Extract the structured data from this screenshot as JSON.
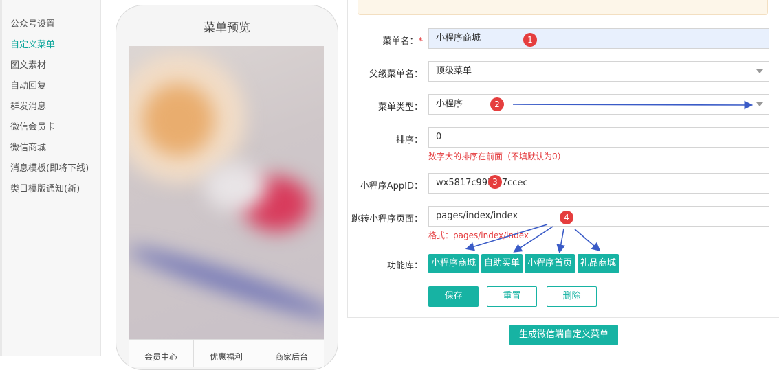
{
  "sidebar": {
    "items": [
      {
        "label": "公众号设置"
      },
      {
        "label": "自定义菜单"
      },
      {
        "label": "图文素材"
      },
      {
        "label": "自动回复"
      },
      {
        "label": "群发消息"
      },
      {
        "label": "微信会员卡"
      },
      {
        "label": "微信商城"
      },
      {
        "label": "消息模板(即将下线)"
      },
      {
        "label": "类目模版通知(新)"
      }
    ],
    "active_index": 1
  },
  "preview": {
    "title": "菜单预览",
    "tabs": [
      "会员中心",
      "优惠福利",
      "商家后台"
    ]
  },
  "form": {
    "menu_name": {
      "label": "菜单名：",
      "required_mark": "*",
      "value": "小程序商城"
    },
    "parent_menu": {
      "label": "父级菜单名：",
      "value": "顶级菜单"
    },
    "menu_type": {
      "label": "菜单类型：",
      "value": "小程序"
    },
    "sort": {
      "label": "排序：",
      "value": "0",
      "hint": "数字大的排序在前面（不填默认为0）"
    },
    "appid": {
      "label": "小程序AppID：",
      "value": "wx5817c99b2  7ccec"
    },
    "page": {
      "label": "跳转小程序页面：",
      "value": "pages/index/index",
      "hint": "格式：pages/index/index"
    },
    "func_lib": {
      "label": "功能库：",
      "buttons": [
        "小程序商城",
        "自助买单",
        "小程序首页",
        "礼品商城"
      ]
    }
  },
  "actions": {
    "save": "保存",
    "reset": "重置",
    "delete": "删除",
    "generate": "生成微信端自定义菜单"
  },
  "annotations": {
    "badges": [
      "1",
      "2",
      "3",
      "4"
    ],
    "badge_color": "#e53e3e",
    "arrow_color": "#3a5bc7"
  },
  "colors": {
    "accent": "#17b3a3",
    "active_text": "#0aa59a",
    "error_text": "#e4393c"
  }
}
